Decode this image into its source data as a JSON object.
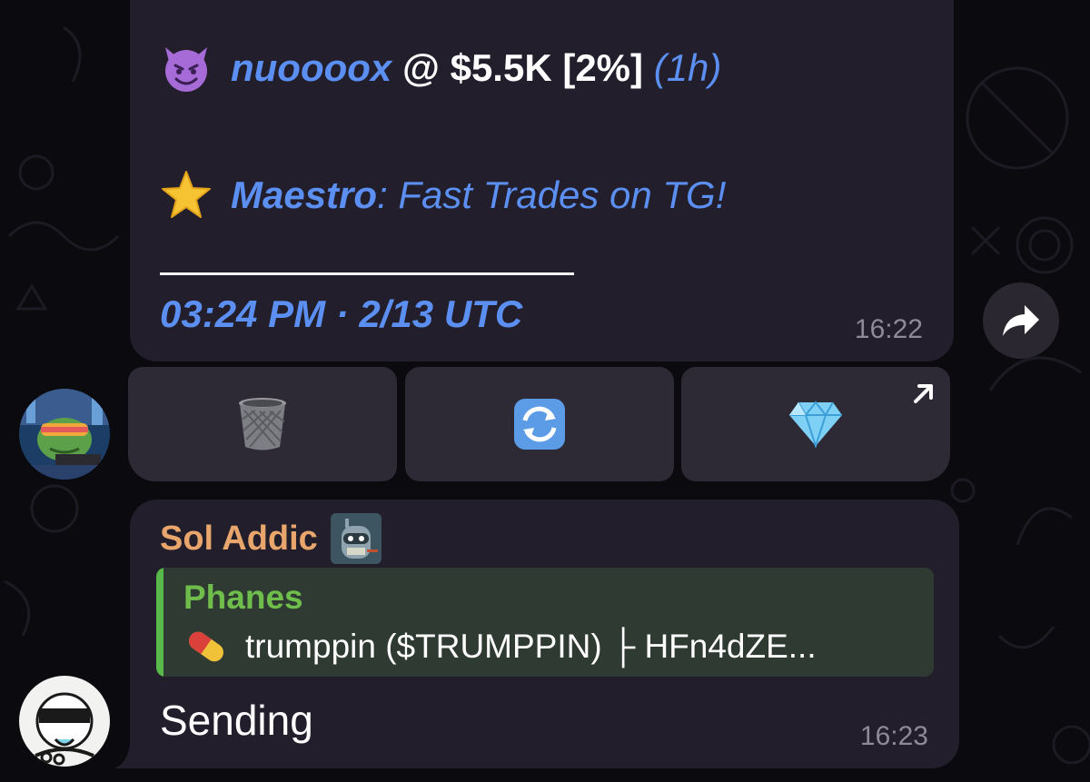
{
  "message1": {
    "user": "nuoooox",
    "price_line": " @ $5.5K [2%] ",
    "paren_open": "(",
    "paren_link": "1h",
    "paren_close": ")",
    "promo_name": "Maestro",
    "promo_text": ": Fast Trades on TG!",
    "timestamp_link": "03:24 PM · 2/13 UTC",
    "time": "16:22"
  },
  "keyboard": {
    "buttons": [
      {
        "icon": "trash-icon"
      },
      {
        "icon": "refresh-icon"
      },
      {
        "icon": "diamond-icon"
      }
    ]
  },
  "message2": {
    "sender": "Sol Addic",
    "reply_name": "Phanes",
    "reply_text": "trumppin ($TRUMPPIN) ├ HFn4dZE...",
    "text": "Sending",
    "time": "16:23"
  },
  "colors": {
    "background": "#0b0a0f",
    "bubble": "#221e2b",
    "link": "#5b8ff1",
    "sender": "#e8a56c",
    "reply_name": "#6fbe4c",
    "reply_bar": "#58b84a"
  }
}
